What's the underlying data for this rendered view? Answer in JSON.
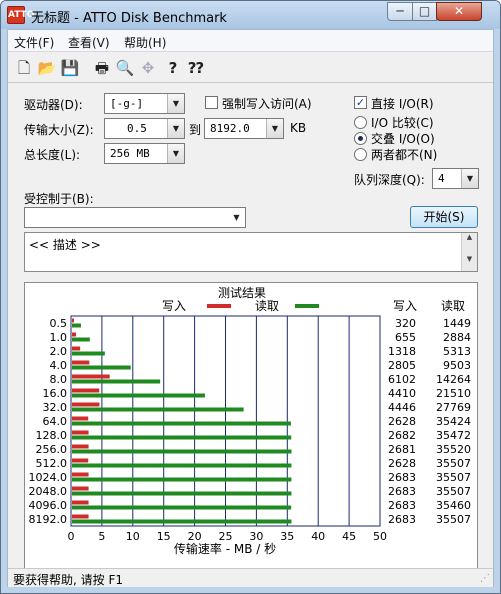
{
  "window": {
    "title": "无标题 - ATTO Disk Benchmark",
    "icon_text": "ATTO",
    "min_glyph": "─",
    "max_glyph": "□",
    "close_glyph": "✕"
  },
  "menu": [
    "文件(F)",
    "查看(V)",
    "帮助(H)"
  ],
  "toolbar": {
    "icons": [
      "new-file-icon",
      "open-folder-icon",
      "save-icon",
      "print-icon",
      "print-preview-icon",
      "move-icon",
      "help-icon",
      "context-help-icon"
    ],
    "glyphs": [
      "🗋",
      "📂",
      "💾",
      "🖶",
      "🔍",
      "✥",
      "?",
      "⁇"
    ]
  },
  "form": {
    "drive_label": "驱动器(D):",
    "drive_value": "[-g-]",
    "force_write_label": "强制写入访问(A)",
    "force_write_checked": false,
    "direct_io_label": "直接 I/O(R)",
    "direct_io_checked": true,
    "transfer_label": "传输大小(Z):",
    "transfer_from": "0.5",
    "to_label": "到",
    "transfer_to": "8192.0",
    "unit_kb": "KB",
    "total_label": "总长度(L):",
    "total_value": "256 MB",
    "io_options": [
      "I/O 比较(C)",
      "交叠 I/O(O)",
      "两者都不(N)"
    ],
    "io_selected": 1,
    "queue_label": "队列深度(Q):",
    "queue_value": "4",
    "controlled_label": "受控制于(B):",
    "controlled_value": "",
    "start_button": "开始(S)",
    "description": "<< 描述 >>"
  },
  "chart_data": {
    "type": "bar",
    "title": "测试结果",
    "legend": [
      {
        "name": "写入",
        "color": "#d02c2c"
      },
      {
        "name": "读取",
        "color": "#1f8a1f"
      }
    ],
    "xlabel": "传输速率 - MB / 秒",
    "xlim": [
      0,
      50
    ],
    "xticks": [
      0,
      5,
      10,
      15,
      20,
      25,
      30,
      35,
      40,
      45,
      50
    ],
    "grid": true,
    "categories": [
      "0.5",
      "1.0",
      "2.0",
      "4.0",
      "8.0",
      "16.0",
      "32.0",
      "64.0",
      "128.0",
      "256.0",
      "512.0",
      "1024.0",
      "2048.0",
      "4096.0",
      "8192.0"
    ],
    "series": [
      {
        "name": "写入",
        "color": "#d02c2c",
        "values": [
          0.32,
          0.655,
          1.318,
          2.805,
          6.102,
          4.41,
          4.446,
          2.628,
          2.682,
          2.681,
          2.628,
          2.683,
          2.683,
          2.683,
          2.683
        ]
      },
      {
        "name": "读取",
        "color": "#1f8a1f",
        "values": [
          1.449,
          2.884,
          5.313,
          9.503,
          14.264,
          21.51,
          27.769,
          35.424,
          35.472,
          35.52,
          35.507,
          35.507,
          35.507,
          35.46,
          35.507
        ]
      }
    ],
    "table_headers": [
      "写入",
      "读取"
    ],
    "table_write": [
      "320",
      "655",
      "1318",
      "2805",
      "6102",
      "4410",
      "4446",
      "2628",
      "2682",
      "2681",
      "2628",
      "2683",
      "2683",
      "2683",
      "2683"
    ],
    "table_read": [
      "1449",
      "2884",
      "5313",
      "9503",
      "14264",
      "21510",
      "27769",
      "35424",
      "35472",
      "35520",
      "35507",
      "35507",
      "35507",
      "35460",
      "35507"
    ]
  },
  "status": {
    "text": "要获得帮助, 请按 F1",
    "grip": "⋰"
  }
}
